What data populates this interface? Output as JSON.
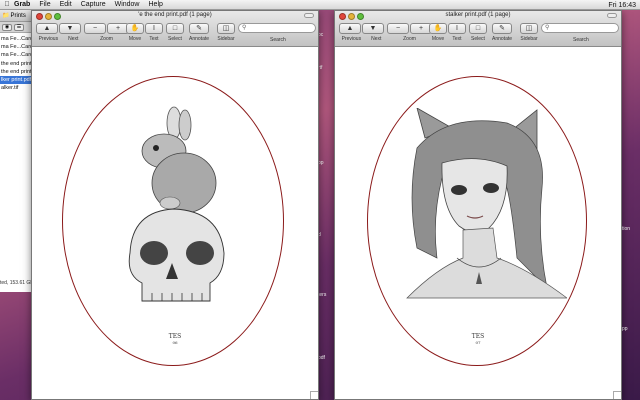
{
  "menubar": {
    "app": "Grab",
    "items": [
      "File",
      "Edit",
      "Capture",
      "Window",
      "Help"
    ],
    "clock": "Fri 16:43"
  },
  "finder": {
    "title": "Prints",
    "files": [
      "ma Fe...Cards",
      "ma Fe...Cards",
      "ma Fe...Cards",
      "the end print.",
      "the end print.",
      "lker print.pdf",
      "alker.tif"
    ],
    "selected_index": 5,
    "status": "ted, 153.61 GB"
  },
  "desktop_labels": [
    "oc",
    "rtf",
    "pp",
    "tion",
    "d",
    "ters",
    "pdf",
    "pp"
  ],
  "window_left": {
    "title": "'e the end print.pdf (1 page)",
    "signature": "TES",
    "signature_sub": "06"
  },
  "window_right": {
    "title": "stalker print.pdf (1 page)",
    "signature": "TES",
    "signature_sub": "07"
  },
  "toolbar": {
    "previous": "Previous",
    "next": "Next",
    "zoom": "Zoom",
    "move": "Move",
    "text": "Text",
    "select": "Select",
    "annotate": "Annotate",
    "sidebar": "Sidebar",
    "search": "Search"
  }
}
